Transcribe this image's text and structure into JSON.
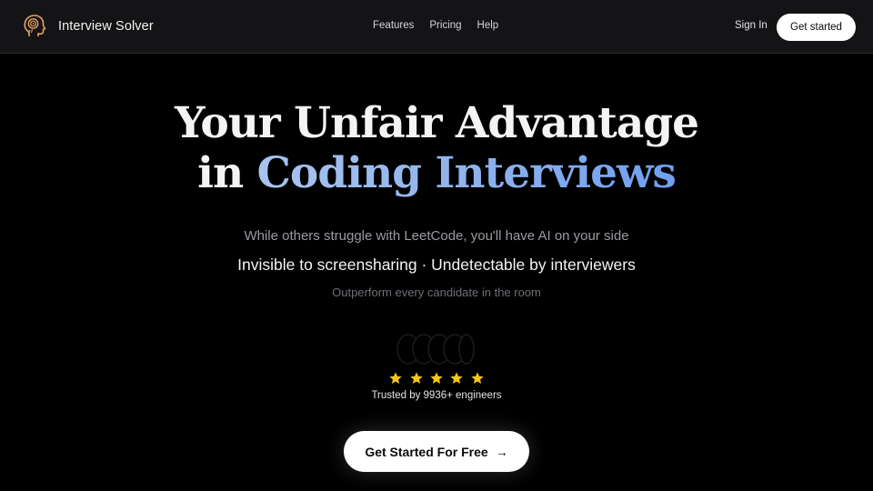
{
  "header": {
    "brand_name": "Interview Solver",
    "logo_icon": "brain-head-icon",
    "nav": [
      "Features",
      "Pricing",
      "Help"
    ],
    "sign_in_label": "Sign In",
    "get_started_label": "Get started"
  },
  "hero": {
    "title_line1": "Your Unfair Advantage",
    "title_line2_prefix": "in ",
    "title_line2_accent": "Coding Interviews",
    "subtitle": "While others struggle with LeetCode, you'll have AI on your side",
    "tagline": "Invisible to screensharing · Undetectable by interviewers",
    "note": "Outperform every candidate in the room"
  },
  "social_proof": {
    "rating_stars": 5,
    "trusted_text": "Trusted by 9936+ engineers"
  },
  "cta": {
    "label": "Get Started For Free",
    "arrow_icon": "arrow-right-icon"
  },
  "colors": {
    "background": "#000000",
    "header_bg": "#141416",
    "accent_gradient_start": "#a8c4ee",
    "accent_gradient_end": "#6f9ff0",
    "star": "#f5c518"
  }
}
